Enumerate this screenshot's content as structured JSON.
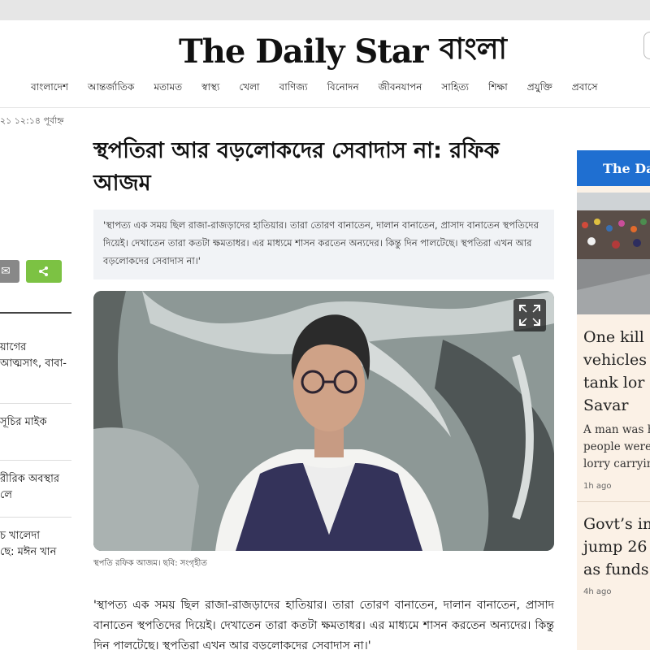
{
  "masthead": {
    "logo_en": "The Daily Star",
    "logo_bn": "বাংলা"
  },
  "nav": {
    "items": [
      "বাংলাদেশ",
      "আন্তর্জাতিক",
      "মতামত",
      "স্বাস্থ্য",
      "খেলা",
      "বাণিজ্য",
      "বিনোদন",
      "জীবনযাপন",
      "সাহিত্য",
      "শিক্ষা",
      "প্রযুক্তি",
      "প্রবাসে"
    ]
  },
  "left": {
    "date": "২১ ১২:১৪ পূর্বাহ্ন",
    "items": [
      [
        "য়াগের",
        "আত্মসাৎ, বাবা-"
      ],
      [
        "সূচির মাইক"
      ],
      [
        "রীরিক অবস্থার",
        "লে"
      ],
      [
        "চ খালেদা",
        "ছে: মঈন খান"
      ]
    ]
  },
  "article": {
    "headline_line1": "স্থপতিরা আর বড়লোকদের সেবাদাস না: রফিক",
    "headline_line2": "আজম",
    "summary": "'স্থাপত্য এক সময় ছিল রাজা-রাজড়াদের হাতিয়ার। তারা তোরণ বানাতেন, দালান বানাতেন, প্রাসাদ বানাতেন স্থপতিদের দিয়েই। দেখাতেন তারা কতটা ক্ষমতাধর। এর মাধ্যমে শাসন করতেন অন্যদের। কিন্তু দিন পালটেছে। স্থপতিরা এখন আর বড়লোকদের সেবাদাস না।'",
    "caption": "স্থপতি রফিক আজম। ছবি: সংগৃহীত",
    "body": "'স্থাপত্য এক সময় ছিল রাজা-রাজড়াদের হাতিয়ার। তারা তোরণ বানাতেন, দালান বানাতেন, প্রাসাদ বানাতেন স্থপতিদের দিয়েই। দেখাতেন তারা কতটা ক্ষমতাধর। এর মাধ্যমে শাসন করতেন অন্যদের। কিন্তু দিন পালটেছে। স্থপতিরা এখন আর বড়লোকদের সেবাদাস না।'"
  },
  "right": {
    "banner": "The Dail",
    "story1": {
      "headline": [
        "One kill",
        "vehicles",
        "tank lor",
        "Savar"
      ],
      "summary": [
        "A man was h",
        "people were",
        "lorry carryin"
      ],
      "time": "1h ago"
    },
    "story2": {
      "headline": [
        "Govt’s in",
        "jump 26",
        "as funds"
      ],
      "time": "4h ago"
    }
  },
  "colors": {
    "share_green": "#7cc243",
    "banner_blue": "#1f6fd1",
    "summary_bg": "#f1f3f6",
    "right_bg": "#fbf1e6"
  }
}
